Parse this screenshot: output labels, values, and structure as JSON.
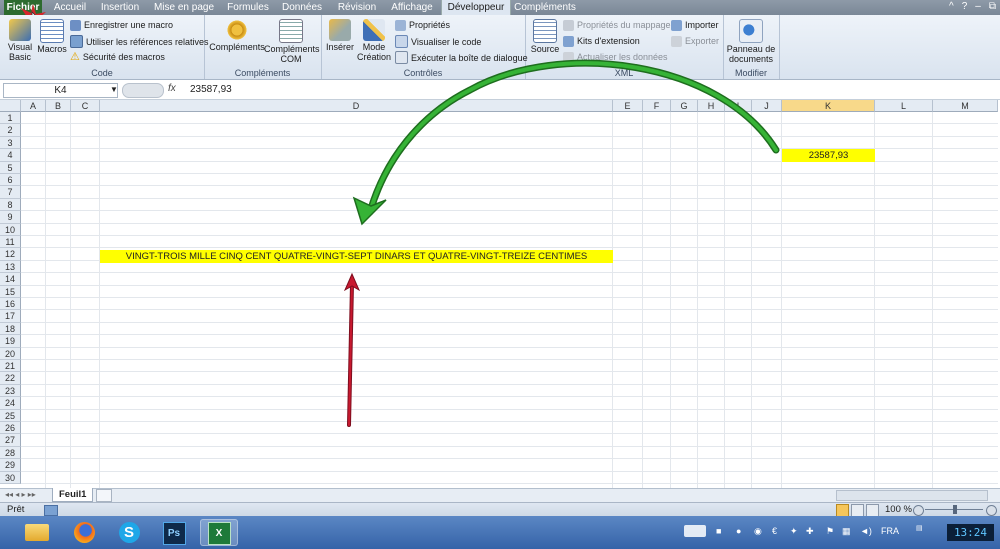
{
  "tabs": [
    "Fichier",
    "Accueil",
    "Insertion",
    "Mise en page",
    "Formules",
    "Données",
    "Révision",
    "Affichage",
    "Développeur",
    "Compléments"
  ],
  "window_controls": [
    "^",
    "?",
    "–",
    "⧉"
  ],
  "ribbon": {
    "code": {
      "label": "Code",
      "visual_basic": "Visual Basic",
      "macros": "Macros",
      "record_macro": "Enregistrer une macro",
      "relative_refs": "Utiliser les références relatives",
      "macro_security": "Sécurité des macros"
    },
    "complements": {
      "label": "Compléments",
      "complements": "Compléments",
      "com": "Compléments COM"
    },
    "controls": {
      "label": "Contrôles",
      "insert": "Insérer",
      "design_mode": "Mode Création",
      "properties": "Propriétés",
      "view_code": "Visualiser le code",
      "run_dialog": "Exécuter la boîte de dialogue"
    },
    "xml": {
      "label": "XML",
      "source": "Source",
      "map_properties": "Propriétés du mappage",
      "expansion_packs": "Kits d'extension",
      "refresh_data": "Actualiser les données",
      "import": "Importer",
      "export": "Exporter"
    },
    "modify": {
      "label": "Modifier",
      "doc_panel": "Panneau de documents"
    }
  },
  "formula_bar": {
    "name_box": "K4",
    "fx": "fx",
    "value": "23587,93"
  },
  "columns": [
    "A",
    "B",
    "C",
    "D",
    "E",
    "F",
    "G",
    "H",
    "I",
    "J",
    "K",
    "L",
    "M"
  ],
  "rows": [
    "1",
    "2",
    "3",
    "4",
    "5",
    "6",
    "7",
    "8",
    "9",
    "10",
    "11",
    "12",
    "13",
    "14",
    "15",
    "16",
    "17",
    "18",
    "19",
    "20",
    "21",
    "22",
    "23",
    "24",
    "25",
    "26",
    "27",
    "28",
    "29",
    "30"
  ],
  "cells": {
    "K4": "23587,93",
    "D12": "VINGT-TROIS MILLE CINQ CENT QUATRE-VINGT-SEPT DINARS ET QUATRE-VINGT-TREIZE CENTIMES"
  },
  "sheet_tab": "Feuil1",
  "status": {
    "ready": "Prêt",
    "zoom": "100 %"
  },
  "taskbar": {
    "lang": "FRA",
    "clock": "13:24"
  },
  "colors": {
    "highlight": "#ffff00",
    "green_arrow": "#2e9a2e",
    "red_arrow": "#b0122a"
  }
}
